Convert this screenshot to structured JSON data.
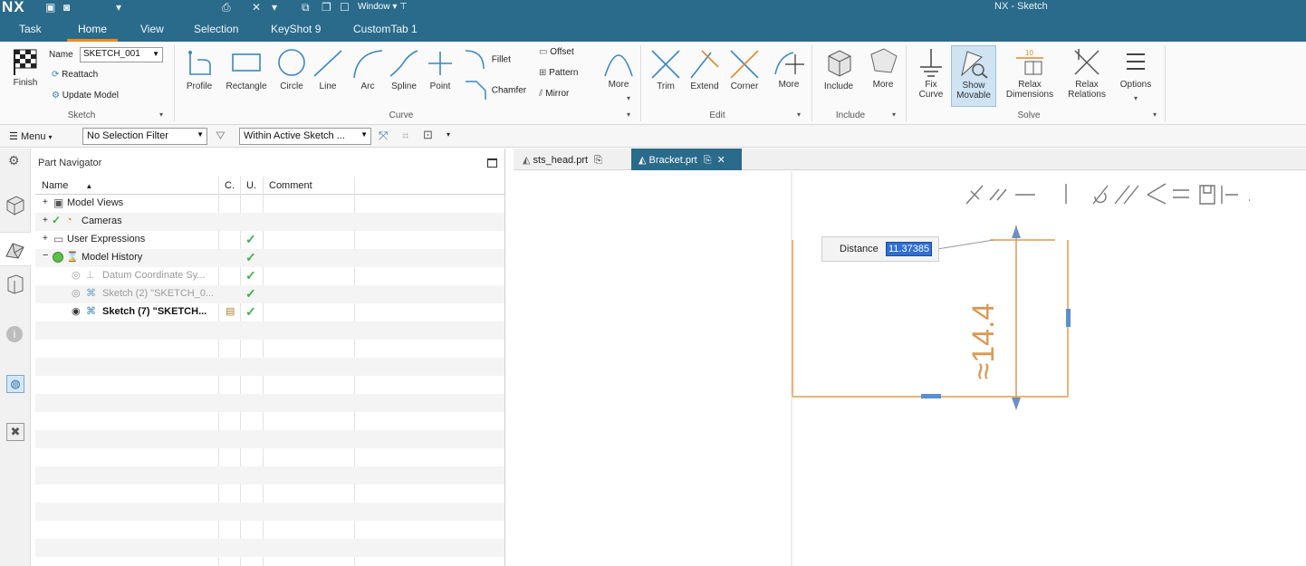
{
  "titlebar": {
    "logo": "NX",
    "window_menu": "Window",
    "title": "NX - Sketch"
  },
  "ribbon_tabs": [
    "Task",
    "Home",
    "View",
    "Selection",
    "KeyShot 9",
    "CustomTab 1"
  ],
  "active_tab": "Home",
  "sketch_group": {
    "finish_label": "Finish",
    "name_label": "Name",
    "name_value": "SKETCH_001",
    "reattach_label": "Reattach",
    "update_model_label": "Update Model",
    "group_label": "Sketch"
  },
  "curve_group": {
    "items": [
      "Profile",
      "Rectangle",
      "Circle",
      "Line",
      "Arc",
      "Spline",
      "Point"
    ],
    "fillet_label": "Fillet",
    "chamfer_label": "Chamfer",
    "offset_label": "Offset",
    "pattern_label": "Pattern",
    "mirror_label": "Mirror",
    "more_label": "More",
    "group_label": "Curve"
  },
  "edit_group": {
    "items": [
      "Trim",
      "Extend",
      "Corner",
      "More"
    ],
    "group_label": "Edit"
  },
  "include_group": {
    "items": [
      "Include",
      "More"
    ],
    "group_label": "Include"
  },
  "solve_group": {
    "fix_curve_1": "Fix",
    "fix_curve_2": "Curve",
    "show_movable_1": "Show",
    "show_movable_2": "Movable",
    "relax_dims_1": "Relax",
    "relax_dims_2": "Dimensions",
    "relax_rel_1": "Relax",
    "relax_rel_2": "Relations",
    "options_label": "Options",
    "group_label": "Solve"
  },
  "filterbar": {
    "menu_label": "Menu",
    "selection_filter": "No Selection Filter",
    "scope": "Within Active Sketch ..."
  },
  "navigator": {
    "title": "Part Navigator",
    "columns": [
      "Name",
      "C.",
      "U.",
      "Comment"
    ],
    "rows": [
      {
        "label": "Model Views",
        "check": false,
        "style": "normal"
      },
      {
        "label": "Cameras",
        "check": false,
        "style": "normal"
      },
      {
        "label": "User Expressions",
        "check": true,
        "style": "normal"
      },
      {
        "label": "Model History",
        "check": true,
        "style": "normal"
      },
      {
        "label": "Datum Coordinate Sy...",
        "check": true,
        "style": "dim"
      },
      {
        "label": "Sketch (2) \"SKETCH_0...",
        "check": true,
        "style": "dim"
      },
      {
        "label": "Sketch (7) \"SKETCH...",
        "check": true,
        "style": "bold"
      }
    ]
  },
  "doc_tabs": [
    {
      "label": "sts_head.prt",
      "active": false
    },
    {
      "label": "Bracket.prt",
      "active": true
    }
  ],
  "graphics": {
    "distance_label": "Distance",
    "distance_value": "11.37385",
    "dimension_text": "≈14.4"
  },
  "colors": {
    "brand": "#2a6a8a",
    "active_tab_underline": "#f08a1c",
    "sketch_geometry": "#e8b47a",
    "dimension": "#d99a55",
    "check": "#3fb04a",
    "selection_highlight": "#2f6fd0"
  }
}
